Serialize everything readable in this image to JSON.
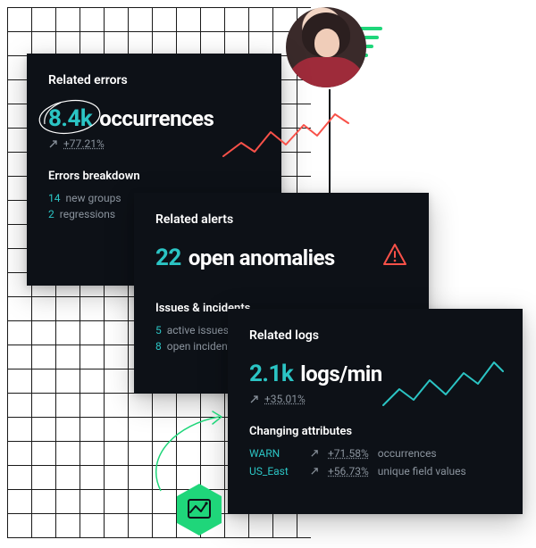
{
  "errors_card": {
    "title": "Related errors",
    "value": "8.4k",
    "unit": "occurrences",
    "delta": "+77.21%",
    "breakdown_title": "Errors breakdown",
    "lines": [
      {
        "num": "14",
        "label": "new groups"
      },
      {
        "num": "2",
        "label": "regressions"
      }
    ]
  },
  "alerts_card": {
    "title": "Related alerts",
    "value": "22",
    "unit": "open anomalies",
    "sub_title": "Issues & incidents",
    "lines": [
      {
        "num": "5",
        "label": "active issues"
      },
      {
        "num": "8",
        "label": "open incidents"
      }
    ]
  },
  "logs_card": {
    "title": "Related logs",
    "value": "2.1k",
    "unit": "logs/min",
    "delta": "+35.01%",
    "sub_title": "Changing attributes",
    "attrs": [
      {
        "key": "WARN",
        "pct": "+71.58%",
        "label": "occurrences"
      },
      {
        "key": "US_East",
        "pct": "+56.73%",
        "label": "unique field values"
      }
    ]
  },
  "colors": {
    "accent": "#2bc4c4",
    "danger": "#f85149",
    "green": "#1fd67a"
  }
}
